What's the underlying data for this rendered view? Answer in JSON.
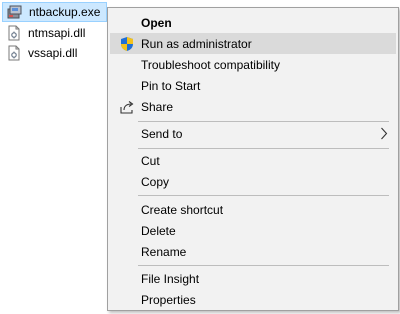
{
  "files": [
    {
      "name": "ntbackup.exe",
      "icon": "executable-icon",
      "selected": true
    },
    {
      "name": "ntmsapi.dll",
      "icon": "dll-file-icon",
      "selected": false
    },
    {
      "name": "vssapi.dll",
      "icon": "dll-file-icon",
      "selected": false
    }
  ],
  "menu": {
    "open": "Open",
    "run_as_admin": "Run as administrator",
    "troubleshoot": "Troubleshoot compatibility",
    "pin_to_start": "Pin to Start",
    "share": "Share",
    "send_to": "Send to",
    "cut": "Cut",
    "copy": "Copy",
    "create_shortcut": "Create shortcut",
    "delete": "Delete",
    "rename": "Rename",
    "file_insight": "File Insight",
    "properties": "Properties"
  },
  "colors": {
    "selection": "#cce8ff",
    "menu_background": "#f2f2f2",
    "menu_hover": "#dadada",
    "shield_blue": "#1f6fd6",
    "shield_yellow": "#f4c21b"
  }
}
